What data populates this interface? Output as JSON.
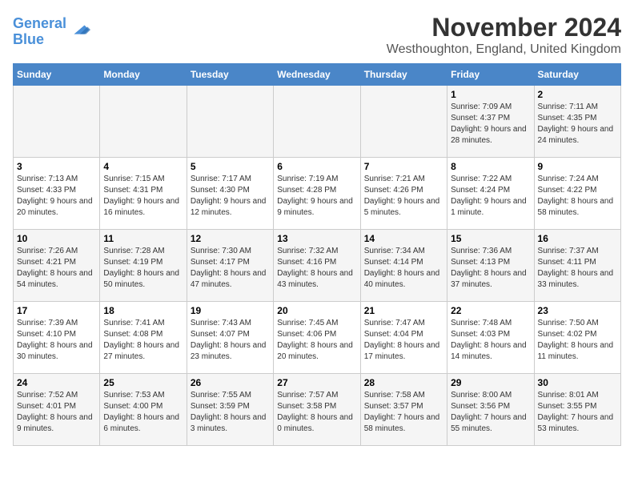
{
  "header": {
    "logo_line1": "General",
    "logo_line2": "Blue",
    "month_title": "November 2024",
    "location": "Westhoughton, England, United Kingdom"
  },
  "days_of_week": [
    "Sunday",
    "Monday",
    "Tuesday",
    "Wednesday",
    "Thursday",
    "Friday",
    "Saturday"
  ],
  "weeks": [
    [
      {
        "day": "",
        "info": ""
      },
      {
        "day": "",
        "info": ""
      },
      {
        "day": "",
        "info": ""
      },
      {
        "day": "",
        "info": ""
      },
      {
        "day": "",
        "info": ""
      },
      {
        "day": "1",
        "info": "Sunrise: 7:09 AM\nSunset: 4:37 PM\nDaylight: 9 hours and 28 minutes."
      },
      {
        "day": "2",
        "info": "Sunrise: 7:11 AM\nSunset: 4:35 PM\nDaylight: 9 hours and 24 minutes."
      }
    ],
    [
      {
        "day": "3",
        "info": "Sunrise: 7:13 AM\nSunset: 4:33 PM\nDaylight: 9 hours and 20 minutes."
      },
      {
        "day": "4",
        "info": "Sunrise: 7:15 AM\nSunset: 4:31 PM\nDaylight: 9 hours and 16 minutes."
      },
      {
        "day": "5",
        "info": "Sunrise: 7:17 AM\nSunset: 4:30 PM\nDaylight: 9 hours and 12 minutes."
      },
      {
        "day": "6",
        "info": "Sunrise: 7:19 AM\nSunset: 4:28 PM\nDaylight: 9 hours and 9 minutes."
      },
      {
        "day": "7",
        "info": "Sunrise: 7:21 AM\nSunset: 4:26 PM\nDaylight: 9 hours and 5 minutes."
      },
      {
        "day": "8",
        "info": "Sunrise: 7:22 AM\nSunset: 4:24 PM\nDaylight: 9 hours and 1 minute."
      },
      {
        "day": "9",
        "info": "Sunrise: 7:24 AM\nSunset: 4:22 PM\nDaylight: 8 hours and 58 minutes."
      }
    ],
    [
      {
        "day": "10",
        "info": "Sunrise: 7:26 AM\nSunset: 4:21 PM\nDaylight: 8 hours and 54 minutes."
      },
      {
        "day": "11",
        "info": "Sunrise: 7:28 AM\nSunset: 4:19 PM\nDaylight: 8 hours and 50 minutes."
      },
      {
        "day": "12",
        "info": "Sunrise: 7:30 AM\nSunset: 4:17 PM\nDaylight: 8 hours and 47 minutes."
      },
      {
        "day": "13",
        "info": "Sunrise: 7:32 AM\nSunset: 4:16 PM\nDaylight: 8 hours and 43 minutes."
      },
      {
        "day": "14",
        "info": "Sunrise: 7:34 AM\nSunset: 4:14 PM\nDaylight: 8 hours and 40 minutes."
      },
      {
        "day": "15",
        "info": "Sunrise: 7:36 AM\nSunset: 4:13 PM\nDaylight: 8 hours and 37 minutes."
      },
      {
        "day": "16",
        "info": "Sunrise: 7:37 AM\nSunset: 4:11 PM\nDaylight: 8 hours and 33 minutes."
      }
    ],
    [
      {
        "day": "17",
        "info": "Sunrise: 7:39 AM\nSunset: 4:10 PM\nDaylight: 8 hours and 30 minutes."
      },
      {
        "day": "18",
        "info": "Sunrise: 7:41 AM\nSunset: 4:08 PM\nDaylight: 8 hours and 27 minutes."
      },
      {
        "day": "19",
        "info": "Sunrise: 7:43 AM\nSunset: 4:07 PM\nDaylight: 8 hours and 23 minutes."
      },
      {
        "day": "20",
        "info": "Sunrise: 7:45 AM\nSunset: 4:06 PM\nDaylight: 8 hours and 20 minutes."
      },
      {
        "day": "21",
        "info": "Sunrise: 7:47 AM\nSunset: 4:04 PM\nDaylight: 8 hours and 17 minutes."
      },
      {
        "day": "22",
        "info": "Sunrise: 7:48 AM\nSunset: 4:03 PM\nDaylight: 8 hours and 14 minutes."
      },
      {
        "day": "23",
        "info": "Sunrise: 7:50 AM\nSunset: 4:02 PM\nDaylight: 8 hours and 11 minutes."
      }
    ],
    [
      {
        "day": "24",
        "info": "Sunrise: 7:52 AM\nSunset: 4:01 PM\nDaylight: 8 hours and 9 minutes."
      },
      {
        "day": "25",
        "info": "Sunrise: 7:53 AM\nSunset: 4:00 PM\nDaylight: 8 hours and 6 minutes."
      },
      {
        "day": "26",
        "info": "Sunrise: 7:55 AM\nSunset: 3:59 PM\nDaylight: 8 hours and 3 minutes."
      },
      {
        "day": "27",
        "info": "Sunrise: 7:57 AM\nSunset: 3:58 PM\nDaylight: 8 hours and 0 minutes."
      },
      {
        "day": "28",
        "info": "Sunrise: 7:58 AM\nSunset: 3:57 PM\nDaylight: 7 hours and 58 minutes."
      },
      {
        "day": "29",
        "info": "Sunrise: 8:00 AM\nSunset: 3:56 PM\nDaylight: 7 hours and 55 minutes."
      },
      {
        "day": "30",
        "info": "Sunrise: 8:01 AM\nSunset: 3:55 PM\nDaylight: 7 hours and 53 minutes."
      }
    ]
  ]
}
